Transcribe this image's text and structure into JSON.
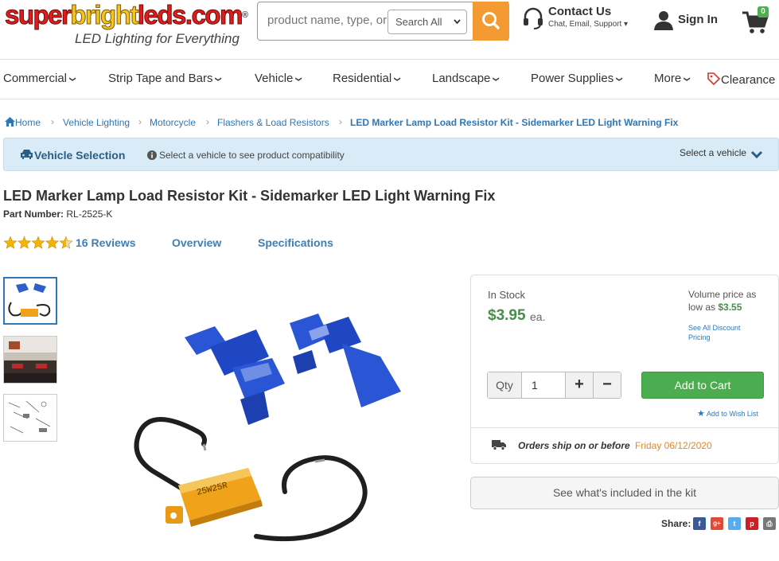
{
  "header": {
    "logo_part1": "super",
    "logo_part2": "bright",
    "logo_part3": "leds",
    "logo_part4": ".com",
    "logo_reg": "®",
    "tagline": "LED Lighting for Everything",
    "search_placeholder": "product name, type, or ke",
    "search_scope": "Search All",
    "contact_title": "Contact Us",
    "contact_sub": "Chat, Email, Support",
    "sign_in": "Sign In",
    "cart_count": "0"
  },
  "nav": {
    "items": [
      "Commercial",
      "Strip Tape and Bars",
      "Vehicle",
      "Residential",
      "Landscape",
      "Power Supplies",
      "More",
      "Clearance"
    ]
  },
  "breadcrumb": [
    "Home",
    "Vehicle Lighting",
    "Motorcycle",
    "Flashers & Load Resistors",
    "LED Marker Lamp Load Resistor Kit - Sidemarker LED Light Warning Fix"
  ],
  "vehicle_bar": {
    "title": "Vehicle Selection",
    "info": "Select a vehicle to see product compatibility",
    "select": "Select a vehicle"
  },
  "product": {
    "title": "LED Marker Lamp Load Resistor Kit - Sidemarker LED Light Warning Fix",
    "part_label": "Part Number:",
    "part_number": "RL-2525-K",
    "rating": 4.5,
    "reviews": "16 Reviews",
    "tab_overview": "Overview",
    "tab_specs": "Specifications",
    "resistor_label": "25W25R"
  },
  "buy_box": {
    "stock": "In Stock",
    "price": "$3.95",
    "unit": "ea.",
    "volume_text": "Volume price as low as",
    "volume_price": "$3.55",
    "discount_link": "See All Discount Pricing",
    "qty_label": "Qty",
    "qty_value": "1",
    "plus": "+",
    "minus": "−",
    "add_to_cart": "Add to Cart",
    "wish_list": "Add to Wish List",
    "ship_text": "Orders ship on or before",
    "ship_date": "Friday 06/12/2020"
  },
  "kit_button": "See what's included in the kit",
  "share": {
    "label": "Share:",
    "icons": [
      "facebook-icon",
      "google-plus-icon",
      "twitter-icon",
      "pinterest-icon",
      "print-icon"
    ]
  },
  "colors": {
    "orange": "#f39a32",
    "green": "#4cad50",
    "link": "#2f77b5",
    "vehicle_bar": "#d8ebf6"
  }
}
